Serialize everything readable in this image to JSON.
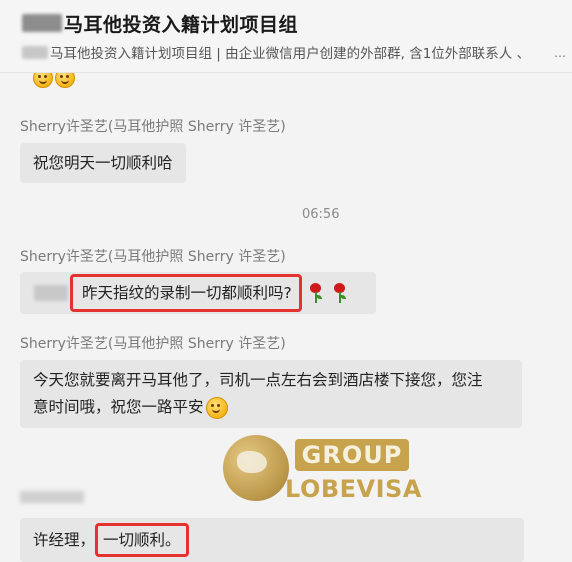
{
  "header": {
    "title": "马耳他投资入籍计划项目组",
    "subtitle": "马耳他投资入籍计划项目组 | 由企业微信用户创建的外部群, 含1位外部联系人 、"
  },
  "messages": [
    {
      "sender": "Sherry许圣艺(马耳他护照 Sherry 许圣艺)",
      "text": "祝您明天一切顺利哈"
    },
    {
      "sender": "Sherry许圣艺(马耳他护照 Sherry 许圣艺)",
      "text": "昨天指纹的录制一切都顺利吗?"
    },
    {
      "sender": "Sherry许圣艺(马耳他护照 Sherry 许圣艺)",
      "lines": [
        "今天您就要离开马耳他了，司机一点左右会到酒店楼下接您，您注",
        "意时间哦，祝您一路平安"
      ]
    },
    {
      "prefix": "许经理，",
      "text": "一切顺利。"
    }
  ],
  "timestamp": "06:56",
  "watermark": {
    "top": "GROUP",
    "bottom": "LOBEVISA"
  },
  "icons": [
    "smile-emoji-icon",
    "rose-emoji-icon",
    "more-icon"
  ],
  "colors": {
    "highlight_box": "#e3322f",
    "bubble": "#e6e6e6",
    "watermark_gold": "#c49b3d"
  }
}
